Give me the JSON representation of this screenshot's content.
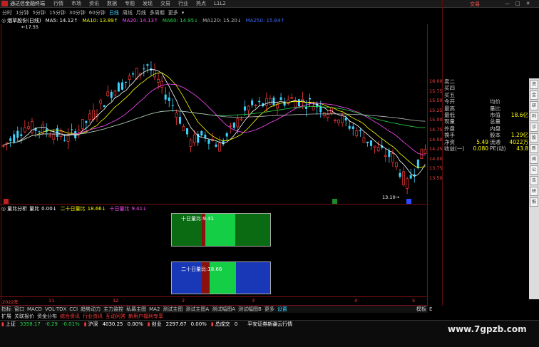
{
  "titlebar": {
    "app_name": "通达信金融终端",
    "menu": [
      "行情",
      "市场",
      "资讯",
      "数据",
      "专题",
      "发现",
      "交易",
      "行业",
      "热点",
      "L1L2"
    ],
    "right_label": "交易"
  },
  "periods": {
    "items": [
      "分时",
      "1分钟",
      "5分钟",
      "15分钟",
      "30分钟",
      "60分钟",
      "日线",
      "周线",
      "月线",
      "多周期",
      "更多"
    ],
    "selected": "日线"
  },
  "ma_legend": {
    "stock": "烟草股份(日线)",
    "ma5": "MA5: 14.12↑",
    "ma10": "MA10: 13.89↑",
    "ma20": "MA20: 14.13↑",
    "ma60": "MA60: 14.95↓",
    "ma120": "MA120: 15.20↓",
    "ma250": "MA250: 15.64↑",
    "high_marker": "17.55"
  },
  "price_axis": [
    "16.00",
    "15.75",
    "15.50",
    "15.25",
    "15.00",
    "14.75",
    "14.50",
    "14.25",
    "14.00",
    "13.75",
    "13.50"
  ],
  "low_marker": "13.10",
  "indicator_legend": {
    "name": "量比分析",
    "label": "量比",
    "v1": "0.00↓",
    "v2_label": "二十日量比",
    "v2": "18.66↓",
    "v3_label": "十日量比",
    "v3": "9.41↓"
  },
  "boxes": {
    "top_label": "十日量比:9.41",
    "bottom_label": "二十日量比:18.66"
  },
  "info_panel": {
    "rows": [
      {
        "k": "卖二",
        "v": "",
        "k2": "",
        "v2": ""
      },
      {
        "k": "买四",
        "v": "",
        "k2": "",
        "v2": ""
      },
      {
        "k": "买五",
        "v": "",
        "k2": "",
        "v2": ""
      },
      {
        "k": "今开",
        "v": "",
        "k2": "均价",
        "v2": ""
      },
      {
        "k": "最高",
        "v": "",
        "k2": "量比",
        "v2": ""
      },
      {
        "k": "最低",
        "v": "",
        "k2": "市值",
        "v2": "18.6亿"
      },
      {
        "k": "现量",
        "v": "",
        "k2": "总量",
        "v2": ""
      },
      {
        "k": "外盘",
        "v": "",
        "k2": "内盘",
        "v2": ""
      },
      {
        "k": "换手",
        "v": "",
        "k2": "股本",
        "v2": "1.29亿"
      },
      {
        "k": "净资",
        "v": "5.49",
        "k2": "流通",
        "v2": "4022万"
      },
      {
        "k": "收益(一)",
        "v": "0.080",
        "k2": "PE(动)",
        "v2": "43.8"
      }
    ]
  },
  "side_tabs": [
    "资",
    "金",
    "研",
    "判",
    "诊",
    "股",
    "新",
    "闻",
    "公",
    "告",
    "研",
    "报"
  ],
  "x_axis": {
    "year": "2022年",
    "labels": [
      "11",
      "12",
      "2",
      "3",
      "4",
      "5"
    ]
  },
  "indicator_tabs": [
    "指标",
    "窗口",
    "MACD",
    "VOL-TDX",
    "CCI",
    "趋势动力",
    "主力监控",
    "私募主图",
    "MA2",
    "测试主图",
    "测试主图A",
    "测试幅图A",
    "测试幅图B",
    "更多",
    "设置"
  ],
  "ext_tabs": [
    "扩展",
    "关联报价",
    "资金分布",
    "综合资讯",
    "行业资讯",
    "互动问答",
    "新用户福利专享"
  ],
  "right_tabs": [
    "模板",
    "E"
  ],
  "ticker": {
    "sh_label": "上证",
    "sh_val": "3358.17",
    "sh_chg": "-0.29",
    "sh_pct": "-0.01%",
    "hs_label": "沪深",
    "hs_val": "4030.25",
    "hs_pct": "0.00%",
    "cy_label": "创业",
    "cy_val": "2297.67",
    "cy_pct": "0.00%",
    "total_label": "总成交",
    "total_val": "0",
    "broker": "平安证券新疆云行情"
  },
  "watermark": "www.7gpzb.com",
  "colors": {
    "up": "#ff3b3b",
    "down": "#3ad3ff",
    "ma5": "#ffffff",
    "ma10": "#ffff00",
    "ma20": "#ff4dff",
    "ma60": "#27d64a",
    "ma120": "#bbbbbb",
    "ma250": "#3a6bff"
  }
}
